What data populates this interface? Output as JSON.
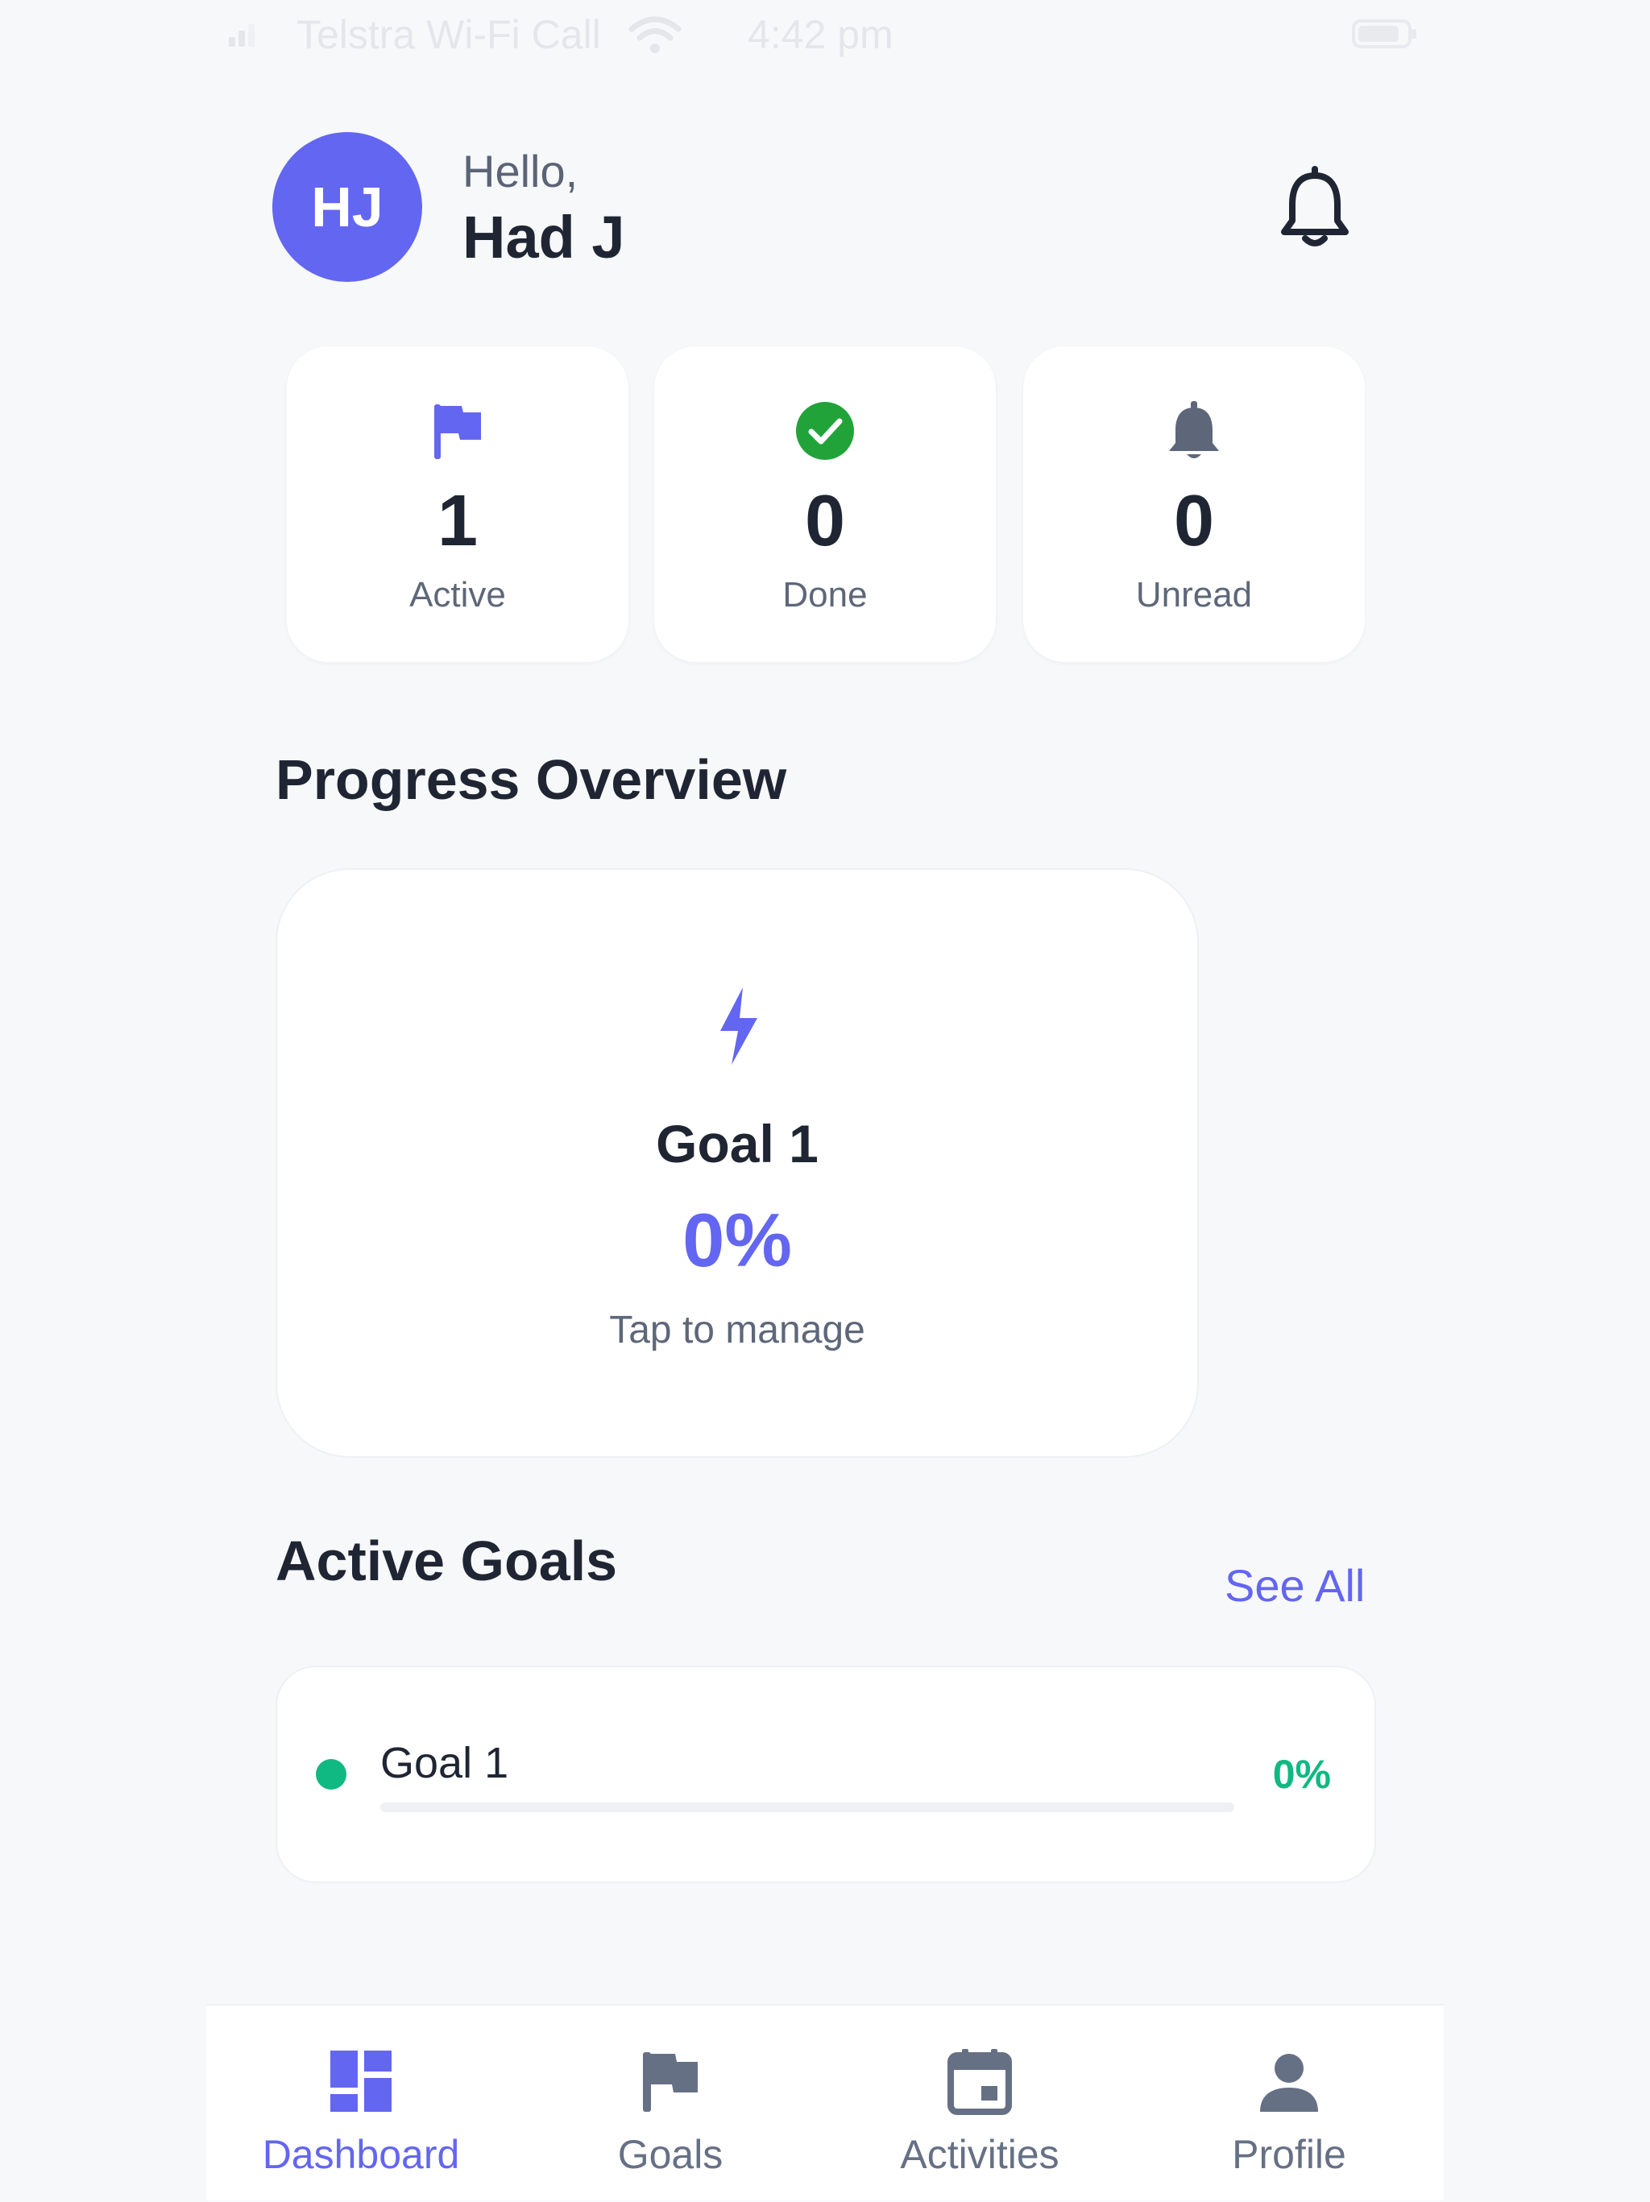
{
  "status_bar": {
    "carrier": "Telstra Wi-Fi Call",
    "time": "4:42 pm"
  },
  "header": {
    "avatar_initials": "HJ",
    "greeting": "Hello,",
    "user_name": "Had J",
    "notification_icon": "bell-icon"
  },
  "stats": [
    {
      "icon": "flag-icon",
      "value": "1",
      "label": "Active",
      "color": "#6366f1"
    },
    {
      "icon": "check-circle-icon",
      "value": "0",
      "label": "Done",
      "color": "#22a33a"
    },
    {
      "icon": "bell-icon",
      "value": "0",
      "label": "Unread",
      "color": "#5e6779"
    }
  ],
  "progress_overview": {
    "title": "Progress Overview",
    "card": {
      "icon": "bolt-icon",
      "goal_name": "Goal 1",
      "percent": "0%",
      "hint": "Tap to manage"
    }
  },
  "active_goals": {
    "title": "Active Goals",
    "see_all": "See All",
    "items": [
      {
        "name": "Goal 1",
        "percent": "0%",
        "progress": 0,
        "status_color": "#10b981"
      }
    ]
  },
  "bottom_nav": {
    "items": [
      {
        "label": "Dashboard",
        "icon": "dashboard-icon",
        "active": true
      },
      {
        "label": "Goals",
        "icon": "flag-icon",
        "active": false
      },
      {
        "label": "Activities",
        "icon": "calendar-icon",
        "active": false
      },
      {
        "label": "Profile",
        "icon": "person-icon",
        "active": false
      }
    ]
  },
  "colors": {
    "accent": "#6366f1",
    "success": "#10b981",
    "background": "#f7f8fa"
  }
}
